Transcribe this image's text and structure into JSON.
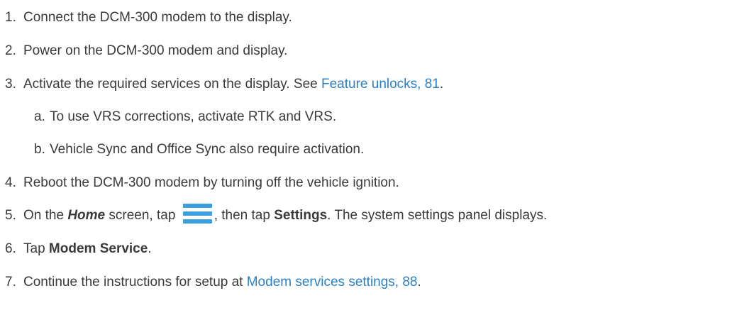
{
  "steps": [
    {
      "num": "1.",
      "text": "Connect the DCM-300 modem to the display."
    },
    {
      "num": "2.",
      "text": "Power on the DCM-300 modem and display."
    },
    {
      "num": "3.",
      "text": "Activate the required services on the display. See ",
      "link": "Feature unlocks, 81",
      "after": "."
    },
    {
      "num": "a.",
      "text": "To use VRS corrections, activate RTK and VRS."
    },
    {
      "num": "b.",
      "text": "Vehicle Sync and Office Sync also require activation."
    },
    {
      "num": "4.",
      "text": "Reboot the DCM-300 modem by turning off the vehicle ignition."
    },
    {
      "num": "5.",
      "text_a": "On the ",
      "home": "Home",
      "text_b": " screen, tap ",
      "icon": "menu-icon",
      "text_c": ", then tap ",
      "settings": "Settings",
      "text_d": ". The system settings panel displays."
    },
    {
      "num": "6.",
      "text": "Tap ",
      "bold": "Modem Service",
      "after": "."
    },
    {
      "num": "7.",
      "text": "Continue the instructions for setup at ",
      "link": "Modem services settings, 88",
      "after": "."
    }
  ],
  "colors": {
    "text": "#3a3a3a",
    "link": "#2a7fc7",
    "icon": "#3b9fe0"
  }
}
